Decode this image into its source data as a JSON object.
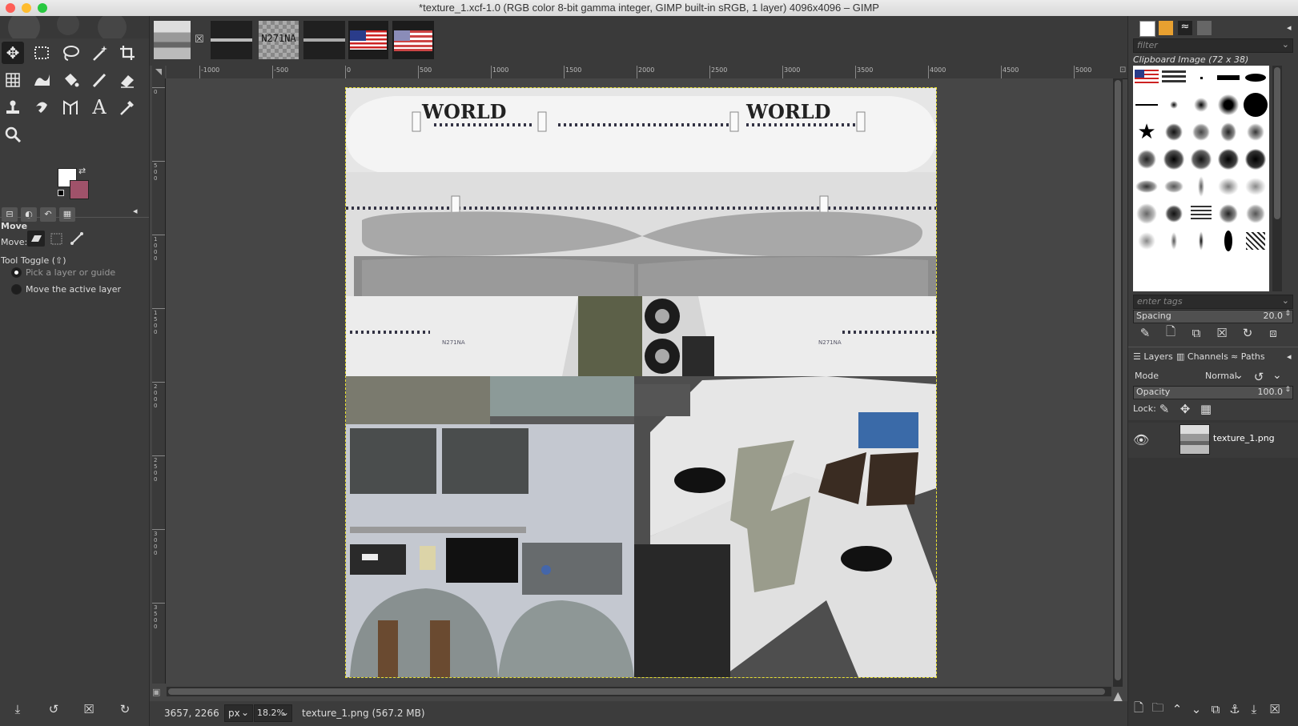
{
  "window": {
    "title": "*texture_1.xcf-1.0 (RGB color 8-bit gamma integer, GIMP built-in sRGB, 1 layer) 4096x4096 – GIMP"
  },
  "toolbox": {
    "tools": [
      "move-icon",
      "rect-select-icon",
      "lasso-icon",
      "fuzzy-select-icon",
      "crop-icon",
      "unified-transform-icon",
      "warp-transform-icon",
      "bucket-fill-icon",
      "paintbrush-icon",
      "eraser-icon",
      "clone-icon",
      "smudge-icon",
      "paths-icon",
      "text-icon",
      "color-picker-icon",
      "zoom-icon"
    ],
    "colors": {
      "foreground": "#ffffff",
      "background": "#a0526a"
    },
    "panel_title": "Move",
    "move_label": "Move:",
    "tool_toggle_label": "Tool Toggle  (⇧)",
    "options": [
      "Pick a layer or guide",
      "Move the active layer"
    ]
  },
  "image_tabs": {
    "plate_text": "N271NA"
  },
  "ruler": {
    "ticks": [
      "-1000",
      "-500",
      "0",
      "500",
      "1000",
      "1500",
      "2000",
      "2500",
      "3000",
      "3500",
      "4000",
      "4500",
      "5000"
    ],
    "v_ticks": [
      "0",
      "500",
      "1000",
      "1500",
      "2000",
      "2500",
      "3000",
      "3500"
    ]
  },
  "texture": {
    "fuselage_text": [
      "WORLD",
      "WORLD"
    ],
    "registration": [
      "N271NA",
      "N271NA"
    ]
  },
  "status": {
    "coords": "3657, 2266",
    "unit": "px",
    "zoom": "18.2%",
    "file_info": "texture_1.png (567.2 MB)"
  },
  "brushes": {
    "filter_placeholder": "filter",
    "clipboard_label": "Clipboard Image (72 x 38)",
    "tags_placeholder": "enter tags",
    "spacing_label": "Spacing",
    "spacing_value": "20.0"
  },
  "layers": {
    "tabs": [
      "Layers",
      "Channels",
      "Paths"
    ],
    "mode_label": "Mode",
    "mode_value": "Normal",
    "opacity_label": "Opacity",
    "opacity_value": "100.0",
    "lock_label": "Lock:",
    "items": [
      {
        "name": "texture_1.png"
      }
    ]
  }
}
